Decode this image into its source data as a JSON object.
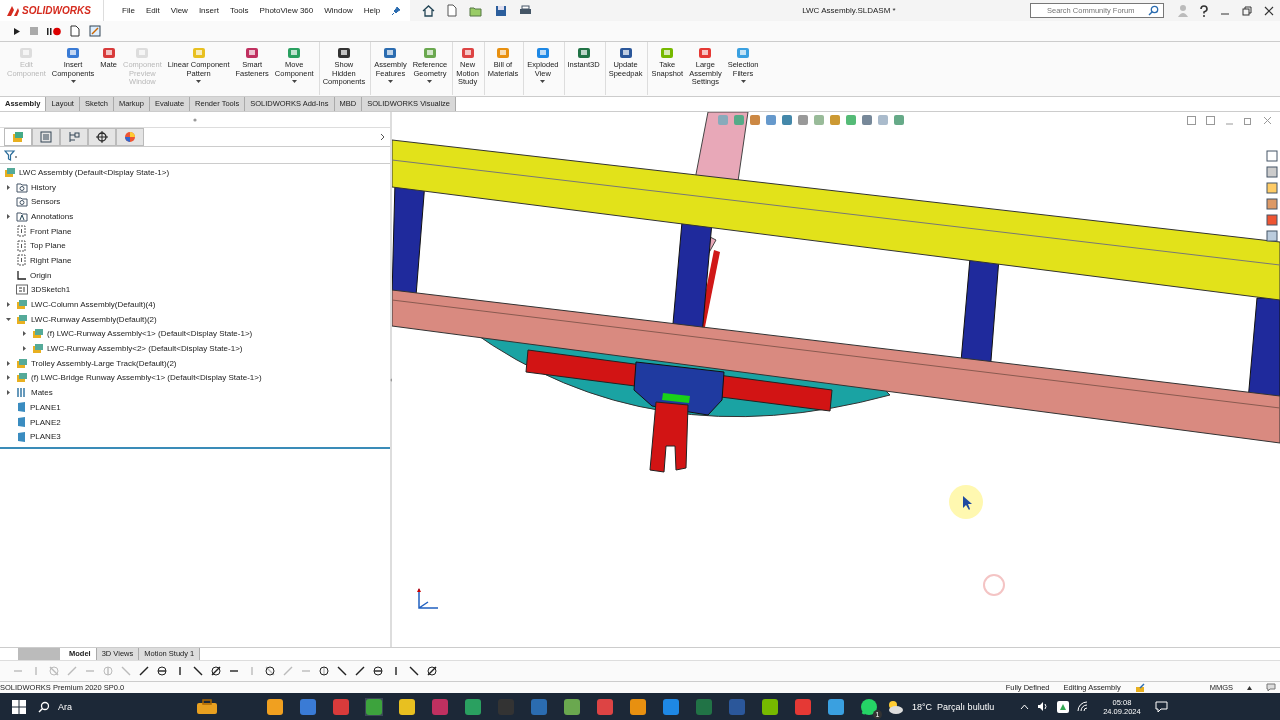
{
  "app": {
    "logo": "SOLIDWORKS",
    "menu": [
      "File",
      "Edit",
      "View",
      "Insert",
      "Tools",
      "PhotoView 360",
      "Window",
      "Help"
    ],
    "document_title": "LWC Assembly.SLDASM *",
    "search": {
      "placeholder": "Search Community Forum"
    }
  },
  "ribbon": [
    {
      "label": "Edit\nComponent",
      "disabled": true,
      "dropdown": false,
      "group_end": false
    },
    {
      "label": "Insert\nComponents",
      "disabled": false,
      "dropdown": true,
      "group_end": false
    },
    {
      "label": "Mate",
      "disabled": false,
      "dropdown": false,
      "group_end": false
    },
    {
      "label": "Component\nPreview\nWindow",
      "disabled": true,
      "dropdown": false,
      "group_end": false
    },
    {
      "label": "Linear Component\nPattern",
      "disabled": false,
      "dropdown": true,
      "group_end": false
    },
    {
      "label": "Smart\nFasteners",
      "disabled": false,
      "dropdown": false,
      "group_end": false
    },
    {
      "label": "Move\nComponent",
      "disabled": false,
      "dropdown": true,
      "group_end": true
    },
    {
      "label": "Show\nHidden\nComponents",
      "disabled": false,
      "dropdown": false,
      "group_end": true
    },
    {
      "label": "Assembly\nFeatures",
      "disabled": false,
      "dropdown": true,
      "group_end": false
    },
    {
      "label": "Reference\nGeometry",
      "disabled": false,
      "dropdown": true,
      "group_end": true
    },
    {
      "label": "New\nMotion\nStudy",
      "disabled": false,
      "dropdown": false,
      "group_end": true
    },
    {
      "label": "Bill of\nMaterials",
      "disabled": false,
      "dropdown": false,
      "group_end": true
    },
    {
      "label": "Exploded\nView",
      "disabled": false,
      "dropdown": true,
      "group_end": true
    },
    {
      "label": "Instant3D",
      "disabled": false,
      "dropdown": false,
      "group_end": true
    },
    {
      "label": "Update\nSpeedpak",
      "disabled": false,
      "dropdown": false,
      "group_end": true
    },
    {
      "label": "Take\nSnapshot",
      "disabled": false,
      "dropdown": false,
      "group_end": false
    },
    {
      "label": "Large\nAssembly\nSettings",
      "disabled": false,
      "dropdown": false,
      "group_end": false
    },
    {
      "label": "Selection\nFilters",
      "disabled": false,
      "dropdown": true,
      "group_end": false
    }
  ],
  "ribbon_tabs": [
    {
      "label": "Assembly",
      "selected": true
    },
    {
      "label": "Layout",
      "selected": false
    },
    {
      "label": "Sketch",
      "selected": false
    },
    {
      "label": "Markup",
      "selected": false
    },
    {
      "label": "Evaluate",
      "selected": false
    },
    {
      "label": "Render Tools",
      "selected": false
    },
    {
      "label": "SOLIDWORKS Add-Ins",
      "selected": false
    },
    {
      "label": "MBD",
      "selected": false
    },
    {
      "label": "SOLIDWORKS Visualize",
      "selected": false
    }
  ],
  "tree": {
    "root": "LWC Assembly  (Default<Display State-1>)",
    "items": [
      {
        "label": "History",
        "kind": "folder",
        "expanded": false
      },
      {
        "label": "Sensors",
        "kind": "folder"
      },
      {
        "label": "Annotations",
        "kind": "annotations",
        "expanded": false
      },
      {
        "label": "Front Plane",
        "kind": "plane"
      },
      {
        "label": "Top Plane",
        "kind": "plane"
      },
      {
        "label": "Right Plane",
        "kind": "plane"
      },
      {
        "label": "Origin",
        "kind": "origin"
      },
      {
        "label": "3DSketch1",
        "kind": "sketch"
      },
      {
        "label": "LWC-Column Assembly(Default)(4)",
        "kind": "assembly",
        "expanded": false
      },
      {
        "label": "LWC-Runway Assembly(Default)(2)",
        "kind": "assembly",
        "expanded": true,
        "children": [
          {
            "label": "(f) LWC-Runway Assembly<1> (Default<Display State-1>)",
            "kind": "assembly",
            "expanded": false
          },
          {
            "label": "LWC-Runway Assembly<2> (Default<Display State-1>)",
            "kind": "assembly",
            "expanded": false
          }
        ]
      },
      {
        "label": "Trolley Assembly-Large Track(Default)(2)",
        "kind": "assembly",
        "expanded": false
      },
      {
        "label": "(f) LWC-Bridge Runway Assembly<1> (Default<Display State-1>)",
        "kind": "assembly",
        "expanded": false
      },
      {
        "label": "Mates",
        "kind": "mates",
        "expanded": false
      },
      {
        "label": "PLANE1",
        "kind": "refplane"
      },
      {
        "label": "PLANE2",
        "kind": "refplane"
      },
      {
        "label": "PLANE3",
        "kind": "refplane"
      }
    ]
  },
  "bottom_tabs": [
    {
      "label": "Model",
      "selected": true
    },
    {
      "label": "3D Views",
      "selected": false
    },
    {
      "label": "Motion Study 1",
      "selected": false
    }
  ],
  "status_bar": {
    "product": "SOLIDWORKS Premium 2020 SP0.0",
    "state": "Fully Defined",
    "mode": "Editing Assembly",
    "units": "MMGS"
  },
  "taskbar": {
    "search": {
      "placeholder": "Ara"
    },
    "weather": "18°C  Parçalı bulutlu",
    "time": "05:08",
    "date": "24.09.2024",
    "whatsapp_badge": "1"
  }
}
